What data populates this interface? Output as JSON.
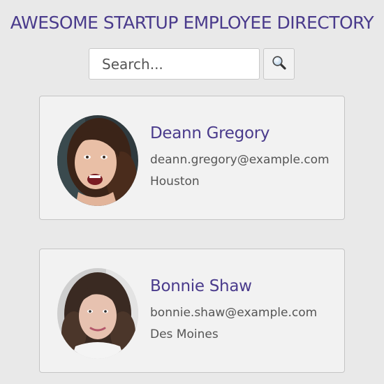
{
  "header": {
    "title": "AWESOME STARTUP EMPLOYEE DIRECTORY"
  },
  "search": {
    "placeholder": "Search...",
    "value": "",
    "button_icon": "magnifying-glass-icon"
  },
  "employees": [
    {
      "name": "Deann Gregory",
      "email": "deann.gregory@example.com",
      "city": "Houston",
      "avatar": "photo-portrait"
    },
    {
      "name": "Bonnie Shaw",
      "email": "bonnie.shaw@example.com",
      "city": "Des Moines",
      "avatar": "photo-portrait"
    }
  ],
  "colors": {
    "accent": "#4a3b8c",
    "background": "#e9e9e9",
    "card": "#f2f2f2",
    "text_muted": "#555555"
  }
}
